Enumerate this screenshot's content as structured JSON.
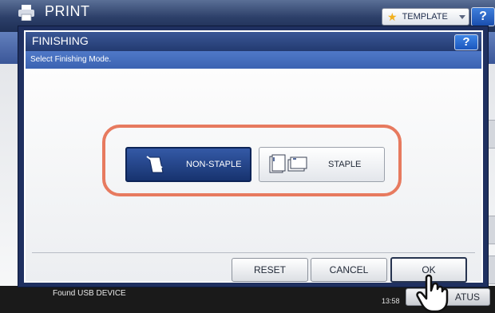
{
  "background_screen": {
    "title": "PRINT",
    "template_label": "TEMPLATE",
    "help_label": "?",
    "status_message": "Found USB DEVICE",
    "clock": "13:58",
    "job_status_label": "ATUS"
  },
  "dialog": {
    "title": "FINISHING",
    "help_label": "?",
    "instruction": "Select Finishing Mode.",
    "options": [
      {
        "label": "NON-STAPLE",
        "icon": "non-staple-icon",
        "selected": true
      },
      {
        "label": "STAPLE",
        "icon": "staple-icon",
        "selected": false
      }
    ],
    "buttons": {
      "reset": "RESET",
      "cancel": "CANCEL",
      "ok": "OK"
    }
  },
  "colors": {
    "header_navy": "#233a70",
    "instruction_blue": "#3b63b2",
    "selected_option": "#17336f",
    "highlight_ring": "#e77a5f"
  }
}
